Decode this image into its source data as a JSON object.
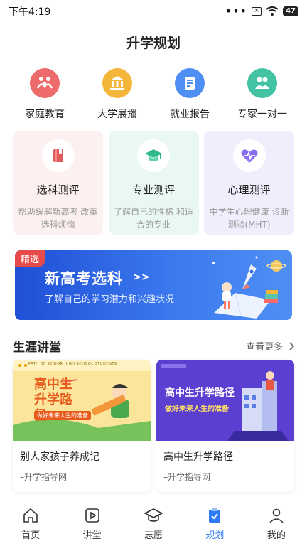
{
  "status_bar": {
    "time": "下午4:19",
    "dots": "•••",
    "sim": "×",
    "battery": "47"
  },
  "page_title": "升学规划",
  "quick_links": [
    {
      "label": "家庭教育",
      "icon": "family-icon",
      "color": "#ee6b6b"
    },
    {
      "label": "大学展播",
      "icon": "university-icon",
      "color": "#f4b63a"
    },
    {
      "label": "就业报告",
      "icon": "report-icon",
      "color": "#4f8ef2"
    },
    {
      "label": "专家一对一",
      "icon": "expert-icon",
      "color": "#43c3a3"
    }
  ],
  "evaluations": [
    {
      "title": "选科测评",
      "desc": "帮助缓解新高考 改革选科烦恼",
      "icon": "book-icon",
      "bg": "#fdf0f0",
      "accent": "#e05a5a"
    },
    {
      "title": "专业测评",
      "desc": "了解自己的性格 和适合的专业",
      "icon": "graduation-cap-icon",
      "bg": "#eaf8f2",
      "accent": "#2fb98c"
    },
    {
      "title": "心理测评",
      "desc": "中学生心理健康 诊断测验(MHT)",
      "icon": "heartbeat-icon",
      "bg": "#f0eefc",
      "accent": "#7a5ee6"
    }
  ],
  "banner": {
    "tag": "精选",
    "title": "新高考选科",
    "arrow": ">>",
    "subtitle": "了解自己的学习潜力和兴趣状况"
  },
  "section": {
    "title": "生涯讲堂",
    "more": "查看更多"
  },
  "courses": [
    {
      "title": "别人家孩子养成记",
      "source": "–升学指导网",
      "thumb_heading": "高中生升学路径",
      "thumb_banner": "PATH OF SENIOR HIGH SCHOOL STUDENTS",
      "thumb_sub": "做好未来人生的准备"
    },
    {
      "title": "高中生升学路径",
      "source": "–升学指导网",
      "thumb_heading": "高中生升学路径",
      "thumb_sub": "做好未来人生的准备"
    }
  ],
  "tabs": [
    {
      "label": "首页",
      "icon": "home-icon",
      "active": false
    },
    {
      "label": "讲堂",
      "icon": "video-play-icon",
      "active": false
    },
    {
      "label": "志愿",
      "icon": "graduation-cap-icon",
      "active": false
    },
    {
      "label": "规划",
      "icon": "clipboard-check-icon",
      "active": true
    },
    {
      "label": "我的",
      "icon": "user-icon",
      "active": false
    }
  ],
  "colors": {
    "accent": "#2f7bf6",
    "banner_tag": "#e64a4a"
  }
}
